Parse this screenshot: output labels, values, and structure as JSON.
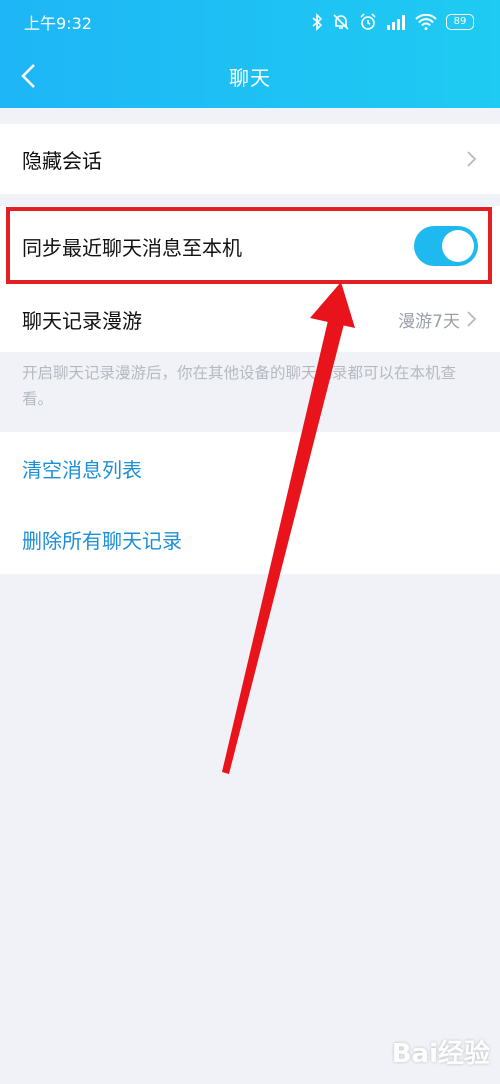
{
  "status_bar": {
    "time": "上午9:32",
    "battery": "89"
  },
  "nav": {
    "title": "聊天"
  },
  "settings": {
    "hide_conversation": "隐藏会话",
    "sync_recent": "同步最近聊天消息至本机",
    "sync_enabled": true,
    "roaming": "聊天记录漫游",
    "roaming_value": "漫游7天",
    "hint": "开启聊天记录漫游后，你在其他设备的聊天记录都可以在本机查看。",
    "clear_list": "清空消息列表",
    "delete_all": "删除所有聊天记录"
  },
  "colors": {
    "header": "#1eb6f6",
    "accent": "#1d8fd6",
    "highlight": "#e41f23"
  },
  "watermark": "Bai经验"
}
